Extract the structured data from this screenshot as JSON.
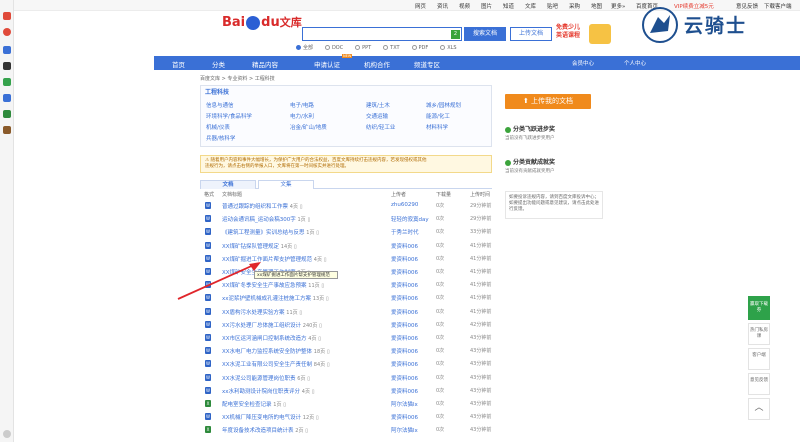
{
  "topnav": [
    "网页",
    "资讯",
    "视频",
    "图片",
    "知道",
    "文库",
    "贴吧",
    "采购",
    "地图",
    "更多»",
    "百度首页",
    "VIP续费立减5元",
    "意见反馈",
    "下载客户端"
  ],
  "logo": {
    "bai": "Bai",
    "du": "du",
    "wenku": "文库"
  },
  "search": {
    "badge": "2",
    "button": "搜索文档",
    "upload": "上传文档"
  },
  "promo": {
    "line1": "免费少儿",
    "line2": "英语课程"
  },
  "filters": [
    "全部",
    "DOC",
    "PPT",
    "TXT",
    "PDF",
    "XLS"
  ],
  "mainnav": {
    "items": [
      "首页",
      "分类",
      "精品内容",
      "申请认证",
      "机构合作",
      "频道专区"
    ],
    "badge": "NEW",
    "right": [
      "会员中心",
      "个人中心"
    ]
  },
  "breadcrumb": [
    "百度文库",
    "专业资料",
    "工程科技"
  ],
  "category": {
    "title": "工程科技",
    "items": [
      "信息与通信",
      "电子/电路",
      "建筑/土木",
      "城乡/园林规划",
      "环境科学/食品科学",
      "电力/水利",
      "交通运输",
      "能源/化工",
      "机械/仪表",
      "冶金/矿山/地质",
      "纺织/轻工业",
      "材料科学",
      "兵器/核科学"
    ]
  },
  "notice": [
    "⚠ 随着用户内容和事件大幅增长，为保护广大用户的合法权益，百度文库持续打击违规内容，若发现侵权或其他",
    "违规行为，请点击右侧的举报入口，文库将在第一时间核实并进行处理。"
  ],
  "tabs": [
    "文档",
    "文集"
  ],
  "thead": {
    "format": "格式",
    "title": "文档标题",
    "uploader": "上传者",
    "downloads": "下载量",
    "time": "上传时间"
  },
  "rows": [
    {
      "icon": "W",
      "title": "普通过跟踪的组织和工作票",
      "pages": "4页",
      "uploader": "zhu60290",
      "downloads": "0次",
      "time": "29分钟前"
    },
    {
      "icon": "W",
      "title": "运动会通讯稿_运动会稿300字",
      "pages": "1页",
      "uploader": "轻轻的寂寞day",
      "downloads": "0次",
      "time": "29分钟前"
    },
    {
      "icon": "W",
      "title": "《建筑工程测量》实训总结与反思",
      "pages": "1页",
      "uploader": "于秀兰时代",
      "downloads": "0次",
      "time": "33分钟前"
    },
    {
      "icon": "W",
      "title": "XX煤矿钻探队管理规定",
      "pages": "14页",
      "uploader": "爱资料006",
      "downloads": "0次",
      "time": "41分钟前"
    },
    {
      "icon": "W",
      "title": "XX煤矿掘进工作面片帮支护管理规范",
      "pages": "4页",
      "uploader": "爱资料006",
      "downloads": "0次",
      "time": "41分钟前"
    },
    {
      "icon": "W",
      "title": "XX煤矿安全生产管理工作制度",
      "pages": "2页",
      "uploader": "爱资料006",
      "downloads": "0次",
      "time": "41分钟前"
    },
    {
      "icon": "W",
      "title": "XX煤矿冬季安全生产事故应急预案",
      "pages": "11页",
      "uploader": "爱资料006",
      "downloads": "0次",
      "time": "41分钟前"
    },
    {
      "icon": "W",
      "title": "xx泥浆护壁机械成孔灌注桩施工方案",
      "pages": "13页",
      "uploader": "爱资料006",
      "downloads": "0次",
      "time": "41分钟前"
    },
    {
      "icon": "W",
      "title": "XX盾构污水处理实验方案",
      "pages": "11页",
      "uploader": "爱资料006",
      "downloads": "0次",
      "time": "41分钟前"
    },
    {
      "icon": "W",
      "title": "XX污水处理厂总体施工组织设计",
      "pages": "240页",
      "uploader": "爱资料006",
      "downloads": "0次",
      "time": "42分钟前"
    },
    {
      "icon": "W",
      "title": "XX市区运河涵闸口控制系统改造方",
      "pages": "4页",
      "uploader": "爱资料006",
      "downloads": "0次",
      "time": "43分钟前"
    },
    {
      "icon": "W",
      "title": "XX水电厂电力监控系统安全防护整体",
      "pages": "18页",
      "uploader": "爱资料006",
      "downloads": "0次",
      "time": "43分钟前"
    },
    {
      "icon": "W",
      "title": "XX水泥工业有限公司安全生产责任制",
      "pages": "84页",
      "uploader": "爱资料006",
      "downloads": "0次",
      "time": "43分钟前"
    },
    {
      "icon": "W",
      "title": "XX水泥公司能源管理岗位职责",
      "pages": "6页",
      "uploader": "爱资料006",
      "downloads": "0次",
      "time": "43分钟前"
    },
    {
      "icon": "W",
      "title": "xx水利勘测设计院岗位职责评分",
      "pages": "4页",
      "uploader": "爱资料006",
      "downloads": "0次",
      "time": "43分钟前"
    },
    {
      "icon": "X",
      "title": "配电室安全检查记录",
      "pages": "1页",
      "uploader": "阿尔法猫lx",
      "downloads": "0次",
      "time": "43分钟前"
    },
    {
      "icon": "W",
      "title": "XX机械厂降压变电所的电气设计",
      "pages": "12页",
      "uploader": "爱资料006",
      "downloads": "0次",
      "time": "43分钟前"
    },
    {
      "icon": "X",
      "title": "年度设备技术改造项目统计表",
      "pages": "2页",
      "uploader": "阿尔法猫lx",
      "downloads": "0次",
      "time": "43分钟前"
    }
  ],
  "tooltip": "xx煤矿掘进工作面片帮支护管理规范",
  "sidebar": {
    "upload": "上传我的文档",
    "s1_title": "分类飞跃进步奖",
    "s1_sub": "当前没有飞跃进步奖用户",
    "s2_title": "分类贡献成就奖",
    "s2_sub": "当前没有贡献成就奖用户",
    "tip": "如要投诉违规内容，请到百度文库投诉中心；如要提出功能问题或意见建议，请点击此处进行反馈。"
  },
  "watermark": "云骑士",
  "floatbar": [
    {
      "label": "赢取下载券"
    },
    {
      "label": "热门私房课"
    },
    {
      "label": "客户端"
    },
    {
      "label": "意见反馈"
    }
  ]
}
